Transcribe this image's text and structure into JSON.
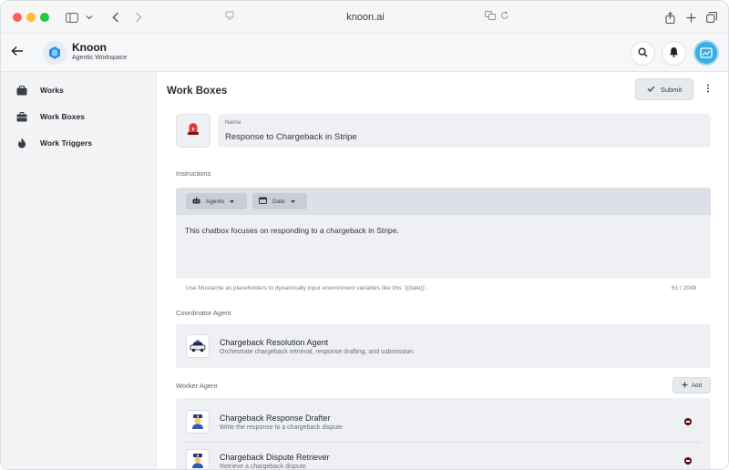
{
  "browser": {
    "url": "knoon.ai"
  },
  "app": {
    "brand_title": "Knoon",
    "brand_subtitle": "Agentic Workspace",
    "accent": "#39aee0"
  },
  "sidebar": {
    "items": [
      {
        "label": "Works",
        "icon": "folder-icon"
      },
      {
        "label": "Work Boxes",
        "icon": "briefcase-icon"
      },
      {
        "label": "Work Triggers",
        "icon": "flame-icon"
      }
    ]
  },
  "main": {
    "page_title": "Work Boxes",
    "submit_label": "Submit",
    "name_label": "Name",
    "name_value": "Response to Chargeback in Stripe",
    "instructions_label": "Instructions",
    "toolbar": {
      "agents_label": "Agents",
      "date_label": "Date"
    },
    "instructions_text": "This chatbox focuses on responding to a chargeback in Stripe.",
    "helper_text": "Use Mustache as placeholders to dynamically input environment variables like this `{{date}}`.",
    "char_counter": "61 / 2048",
    "coordinator_label": "Coordinator Agent",
    "coordinator": {
      "name": "Chargeback Resolution Agent",
      "description": "Orchestrate chargeback retrieval, response drafting, and submission."
    },
    "worker_label": "Worker Agent",
    "add_label": "Add",
    "workers": [
      {
        "name": "Chargeback Response Drafter",
        "description": "Write the response to a chargeback dispute"
      },
      {
        "name": "Chargeback Dispute Retriever",
        "description": "Retrieve a chargeback dispute."
      }
    ]
  }
}
